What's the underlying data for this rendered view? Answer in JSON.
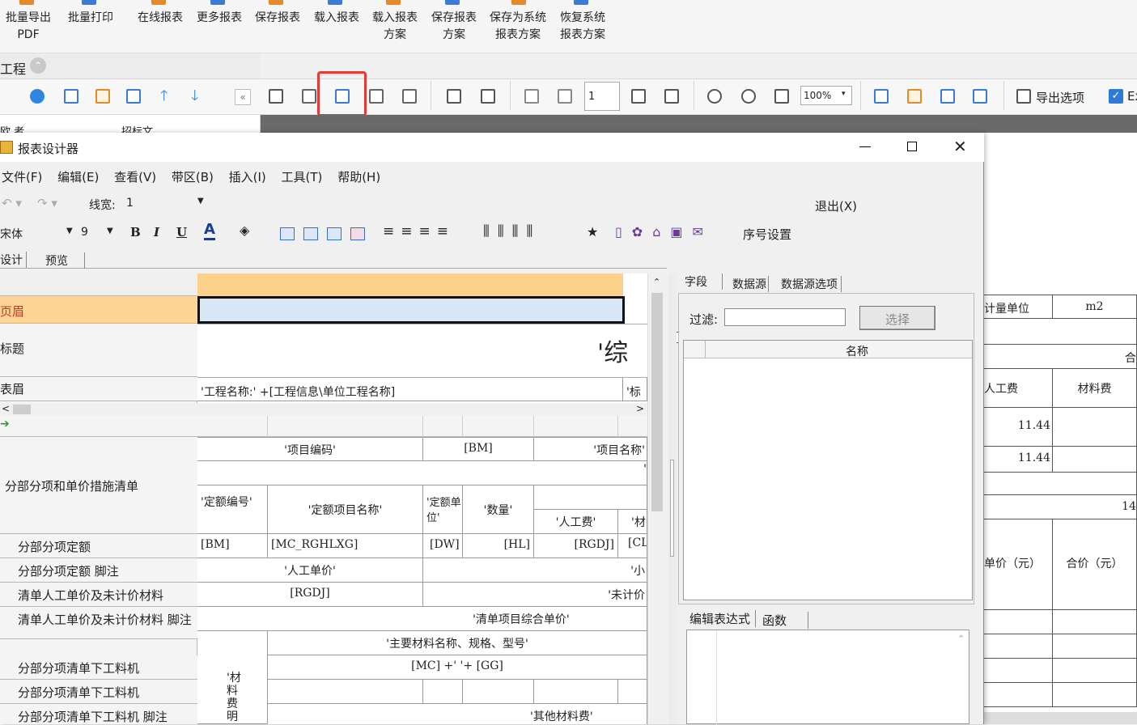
{
  "top_toolbar": [
    {
      "label": "批量导出\nPDF"
    },
    {
      "label": "批量打印"
    },
    {
      "label": "在线报表"
    },
    {
      "label": "更多报表"
    },
    {
      "label": "保存报表"
    },
    {
      "label": "载入报表"
    },
    {
      "label": "载入报表\n方案"
    },
    {
      "label": "保存报表\n方案"
    },
    {
      "label": "保存为系统\n报表方案"
    },
    {
      "label": "恢复系统\n报表方案"
    }
  ],
  "left_panel_title": "工程",
  "tree_partial_label": "招标文",
  "tree_left_partial": "欧 者",
  "preview_toolbar": {
    "page_input": "1",
    "zoom": "100%",
    "export_options": "导出选项",
    "ex_label": "Ex"
  },
  "designer": {
    "title": "报表设计器",
    "menu": [
      "文件(F)",
      "编辑(E)",
      "查看(V)",
      "带区(B)",
      "插入(I)",
      "工具(T)",
      "帮助(H)"
    ],
    "line_width_label": "线宽:",
    "line_width_value": "1",
    "exit_label": "退出(X)",
    "font_name": "宋体",
    "font_size": "9",
    "bold": "B",
    "italic": "I",
    "underline": "U",
    "font_color": "A",
    "seq_setting": "序号设置",
    "tabs": [
      "设计",
      "预览"
    ],
    "bands": [
      {
        "label": "页眉"
      },
      {
        "label": "标题"
      },
      {
        "label": "表眉"
      },
      {
        "label": "分部分项和单价措施清单"
      },
      {
        "label": "分部分项定额"
      },
      {
        "label": "分部分项定额 脚注"
      },
      {
        "label": "清单人工单价及未计价材料"
      },
      {
        "label": "清单人工单价及未计价材料 脚注"
      },
      {
        "label": "分部分项清单下工料机"
      },
      {
        "label": "分部分项清单下工料机"
      },
      {
        "label": "分部分项清单下工料机 脚注"
      }
    ],
    "cells": {
      "title_text": "'综",
      "header_left": "'工程名称:' +[工程信息\\单位工程名称]",
      "header_right": "'标",
      "item_code": "'项目编码'",
      "bm": "[BM]",
      "item_name": "'项目名称'",
      "quote_mark": "'",
      "quota_no": "'定额编号'",
      "quota_name": "'定额项目名称'",
      "quota_unit": "'定额单位'",
      "quantity": "'数量'",
      "labor_fee": "'人工费'",
      "mat_partial": "'材",
      "d_bm": "[BM]",
      "d_name": "[MC_RGHLXG]",
      "d_dw": "[DW]",
      "d_hl": "[HL]",
      "d_rgdj": "[RGDJ]",
      "d_cl": "[CL",
      "labor_price": "'人工单价'",
      "subtotal": "'小",
      "rgdj": "[RGDJ]",
      "unpriced": "'未计价",
      "comp_price": "'清单项目综合单价'",
      "main_mat": "'主要材料名称、规格、型号'",
      "mc_gg": "[MC] +' '+ [GG]",
      "mat_detail": "'材料费明",
      "other_mat": "'其他材料费'"
    },
    "right_tabs": [
      "字段",
      "数据源",
      "数据源选项"
    ],
    "filter_label": "过滤:",
    "select_button": "选择",
    "name_column": "名称",
    "expr_tabs": [
      "编辑表达式",
      "函数"
    ]
  },
  "report_preview": {
    "unit_label": "计量单位",
    "unit_value": "m2",
    "partial_he": "合",
    "labor_fee": "人工费",
    "material_fee": "材料费",
    "val1": "11.44",
    "val2": "11.44",
    "partial_14": "14",
    "unit_price": "单价（元）",
    "total_price": "合价（元）"
  }
}
